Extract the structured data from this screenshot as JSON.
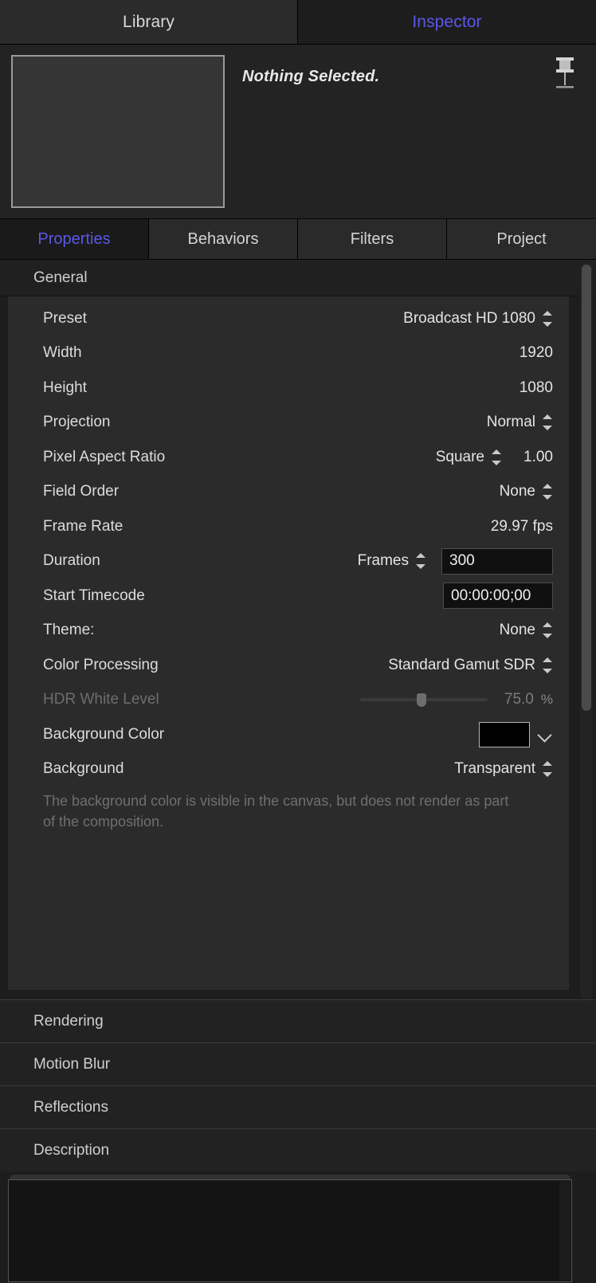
{
  "window": {
    "top_tabs": [
      {
        "label": "Library",
        "active": false
      },
      {
        "label": "Inspector",
        "active": true
      }
    ],
    "accent_color": "#5b57e8"
  },
  "header": {
    "status_text": "Nothing Selected.",
    "pin_icon": "pushpin-icon"
  },
  "category_tabs": [
    {
      "label": "Properties",
      "active": true
    },
    {
      "label": "Behaviors",
      "active": false
    },
    {
      "label": "Filters",
      "active": false
    },
    {
      "label": "Project",
      "active": false
    }
  ],
  "general": {
    "title": "General",
    "rows": {
      "preset": {
        "label": "Preset",
        "value": "Broadcast HD 1080"
      },
      "width": {
        "label": "Width",
        "value": "1920"
      },
      "height": {
        "label": "Height",
        "value": "1080"
      },
      "projection": {
        "label": "Projection",
        "value": "Normal"
      },
      "par": {
        "label": "Pixel Aspect Ratio",
        "value": "Square",
        "numeric": "1.00"
      },
      "field_order": {
        "label": "Field Order",
        "value": "None"
      },
      "frame_rate": {
        "label": "Frame Rate",
        "value": "29.97 fps"
      },
      "duration": {
        "label": "Duration",
        "value": "Frames",
        "field": "300"
      },
      "start_tc": {
        "label": "Start Timecode",
        "field": "00:00:00;00"
      },
      "theme": {
        "label": "Theme:",
        "value": "None"
      },
      "color_proc": {
        "label": "Color Processing",
        "value": "Standard Gamut SDR"
      },
      "hdr_white": {
        "label": "HDR White Level",
        "value": "75.0",
        "unit": "%",
        "slider_pct": 48,
        "disabled": true
      },
      "bg_color": {
        "label": "Background Color",
        "swatch_hex": "#000000"
      },
      "background": {
        "label": "Background",
        "value": "Transparent"
      }
    },
    "help_text": "The background color is visible in the canvas, but does not render as part of the composition."
  },
  "collapsed_sections": [
    {
      "label": "Rendering"
    },
    {
      "label": "Motion Blur"
    },
    {
      "label": "Reflections"
    },
    {
      "label": "Description"
    }
  ],
  "description_field": {
    "value": "",
    "placeholder": ""
  }
}
